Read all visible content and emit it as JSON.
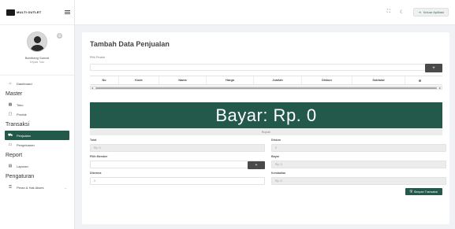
{
  "brand": {
    "logo_text": "MULTI OUTLET"
  },
  "profile": {
    "name": "Bambang Sanusi",
    "role": "Kepala Toko"
  },
  "sidebar": {
    "items": [
      {
        "type": "item",
        "label": "Dashboard",
        "icon": "home-icon"
      },
      {
        "type": "section",
        "label": "Master"
      },
      {
        "type": "item",
        "label": "Toko",
        "icon": "store-icon"
      },
      {
        "type": "item",
        "label": "Produk",
        "icon": "box-icon"
      },
      {
        "type": "section",
        "label": "Transaksi"
      },
      {
        "type": "item",
        "label": "Penjualan",
        "icon": "cart-icon",
        "active": true
      },
      {
        "type": "item",
        "label": "Pengeluaran",
        "icon": "wallet-icon"
      },
      {
        "type": "section",
        "label": "Report"
      },
      {
        "type": "item",
        "label": "Laporan",
        "icon": "report-icon"
      },
      {
        "type": "section",
        "label": "Pengaturan"
      },
      {
        "type": "item",
        "label": "Peran & Hak Akses",
        "icon": "key-icon",
        "caret": true
      }
    ]
  },
  "topbar": {
    "logout_label": "Keluar Aplikasi"
  },
  "form": {
    "title": "Tambah Data Penjualan",
    "product_label": "Pilih Produk",
    "add_product_label": "+",
    "table_headers": [
      "No",
      "Kode",
      "Nama",
      "Harga",
      "Jumlah",
      "Diskon",
      "Subtotal",
      "⚙"
    ],
    "bayar": "Bayar: Rp. 0",
    "terbilang": "Rupiah",
    "total_label": "Total",
    "total_value": "Rp. 0",
    "diskon_label": "Diskon",
    "diskon_value": "0",
    "member_label": "Pilih Member",
    "member_btn": "+",
    "bayar_label": "Bayar",
    "bayar_value": "Rp. 0",
    "diterima_label": "Diterima",
    "diterima_value": "0",
    "kembalian_label": "Kembalian",
    "kembalian_value": "Rp. 0",
    "save_label": "Simpan Transaksi"
  },
  "colors": {
    "primary": "#22594a",
    "dark_button": "#4a4a4a"
  }
}
